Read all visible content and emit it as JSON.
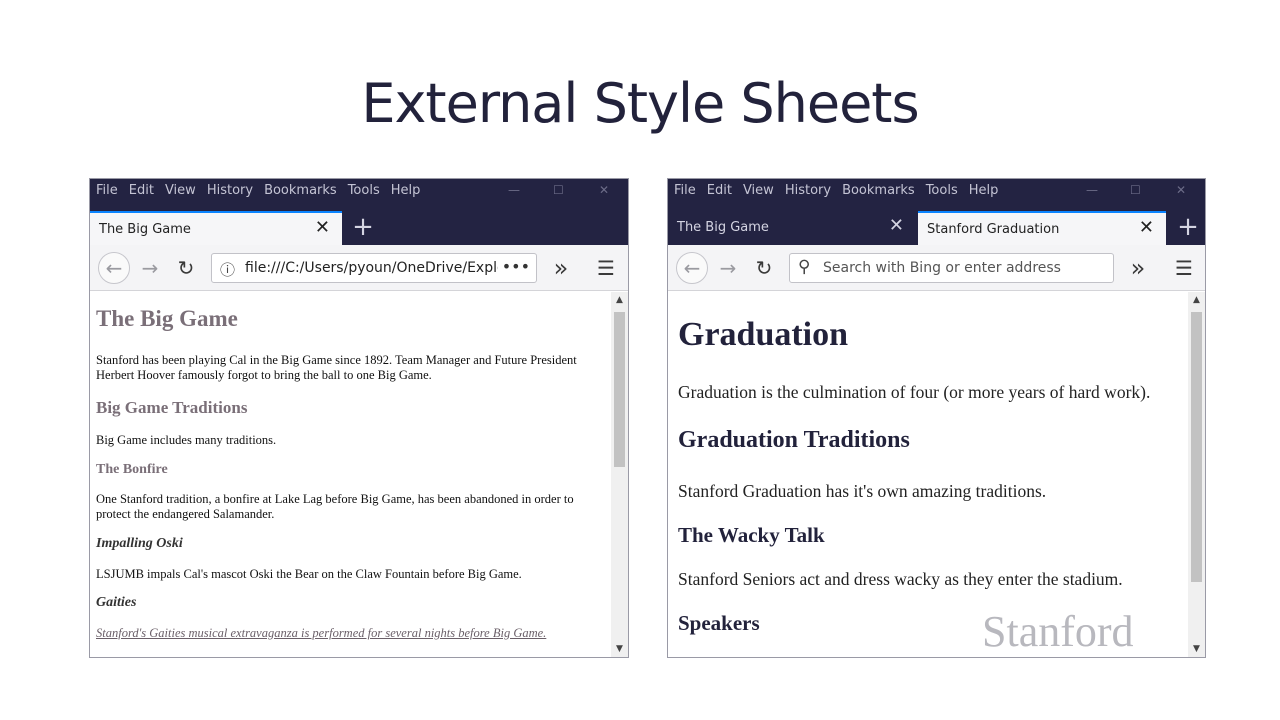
{
  "slide": {
    "title": "External Style Sheets",
    "watermark": "Stanford"
  },
  "menu_labels": [
    "File",
    "Edit",
    "View",
    "History",
    "Bookmarks",
    "Tools",
    "Help"
  ],
  "window_controls": {
    "minimize": "—",
    "maximize": "☐",
    "close": "✕"
  },
  "left_window": {
    "tabs": [
      {
        "label": "The Big Game",
        "close": "✕"
      }
    ],
    "new_tab": "+",
    "url": "file:///C:/Users/pyoun/OneDrive/Explo",
    "url_more": "•••",
    "overflow": "»",
    "hamburger": "☰",
    "page": {
      "h1": "The Big Game",
      "p1": "Stanford has been playing Cal in the Big Game since 1892. Team Manager and Future President Herbert Hoover famously forgot to bring the ball to one Big Game.",
      "h2": "Big Game Traditions",
      "p2": "Big Game includes many traditions.",
      "h3": "The Bonfire",
      "p3": "One Stanford tradition, a bonfire at Lake Lag before Big Game, has been abandoned in order to protect the endangered Salamander.",
      "h4": "Impalling Oski",
      "p4": "LSJUMB impals Cal's mascot Oski the Bear on the Claw Fountain before Big Game.",
      "h5": "Gaities",
      "p5": "Stanford's Gaities musical extravaganza is performed for several nights before Big Game."
    }
  },
  "right_window": {
    "tabs": [
      {
        "label": "The Big Game",
        "close": "✕"
      },
      {
        "label": "Stanford Graduation",
        "close": "✕"
      }
    ],
    "new_tab": "+",
    "search_placeholder": "Search with Bing or enter address",
    "overflow": "»",
    "hamburger": "☰",
    "page": {
      "h1": "Graduation",
      "p1": "Graduation is the culmination of four (or more years of hard work).",
      "h2": "Graduation Traditions",
      "p2": "Stanford Graduation has it's own amazing traditions.",
      "h3": "The Wacky Talk",
      "p3": "Stanford Seniors act and dress wacky as they enter the stadium.",
      "h4": "Speakers"
    }
  },
  "icons": {
    "back": "back-arrow-icon",
    "forward": "forward-arrow-icon",
    "reload": "reload-icon",
    "info": "info-icon",
    "search": "search-icon"
  }
}
